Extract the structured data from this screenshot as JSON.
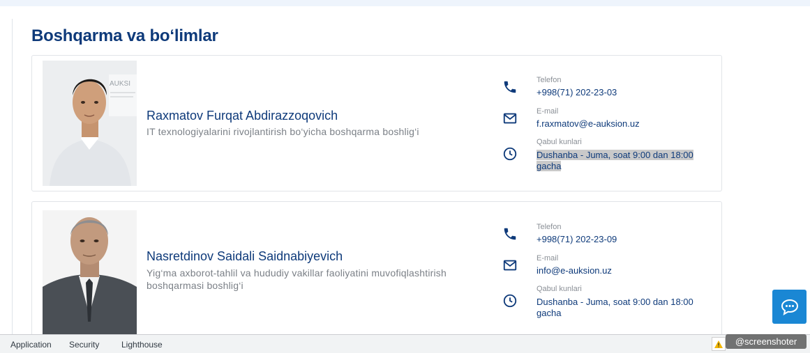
{
  "page": {
    "title": "Boshqarma va bo‘limlar"
  },
  "staff": [
    {
      "name": "Raxmatov Furqat Abdirazzoqovich",
      "role": "IT texnologiyalarini rivojlantirish bo‘yicha boshqarma boshlig‘i",
      "phone_label": "Telefon",
      "phone": "+998(71) 202-23-03",
      "email_label": "E-mail",
      "email": "f.raxmatov@e-auksion.uz",
      "hours_label": "Qabul kunlari",
      "hours": "Dushanba - Juma, soat 9:00 dan 18:00 gacha",
      "photo_banner": "AUKSI"
    },
    {
      "name": "Nasretdinov Saidali Saidnabiyevich",
      "role": "Yig‘ma axborot-tahlil va hududiy vakillar faoliyatini muvofiqlashtirish boshqarmasi boshlig‘i",
      "phone_label": "Telefon",
      "phone": "+998(71) 202-23-09",
      "email_label": "E-mail",
      "email": "info@e-auksion.uz",
      "hours_label": "Qabul kunlari",
      "hours": "Dushanba - Juma, soat 9:00 dan 18:00 gacha"
    }
  ],
  "devtools": {
    "tabs": [
      "Application",
      "Security",
      "Lighthouse"
    ]
  },
  "watermark": "@screenshoter",
  "colors": {
    "accent": "#0e3a7a",
    "chat": "#1a87d4"
  }
}
